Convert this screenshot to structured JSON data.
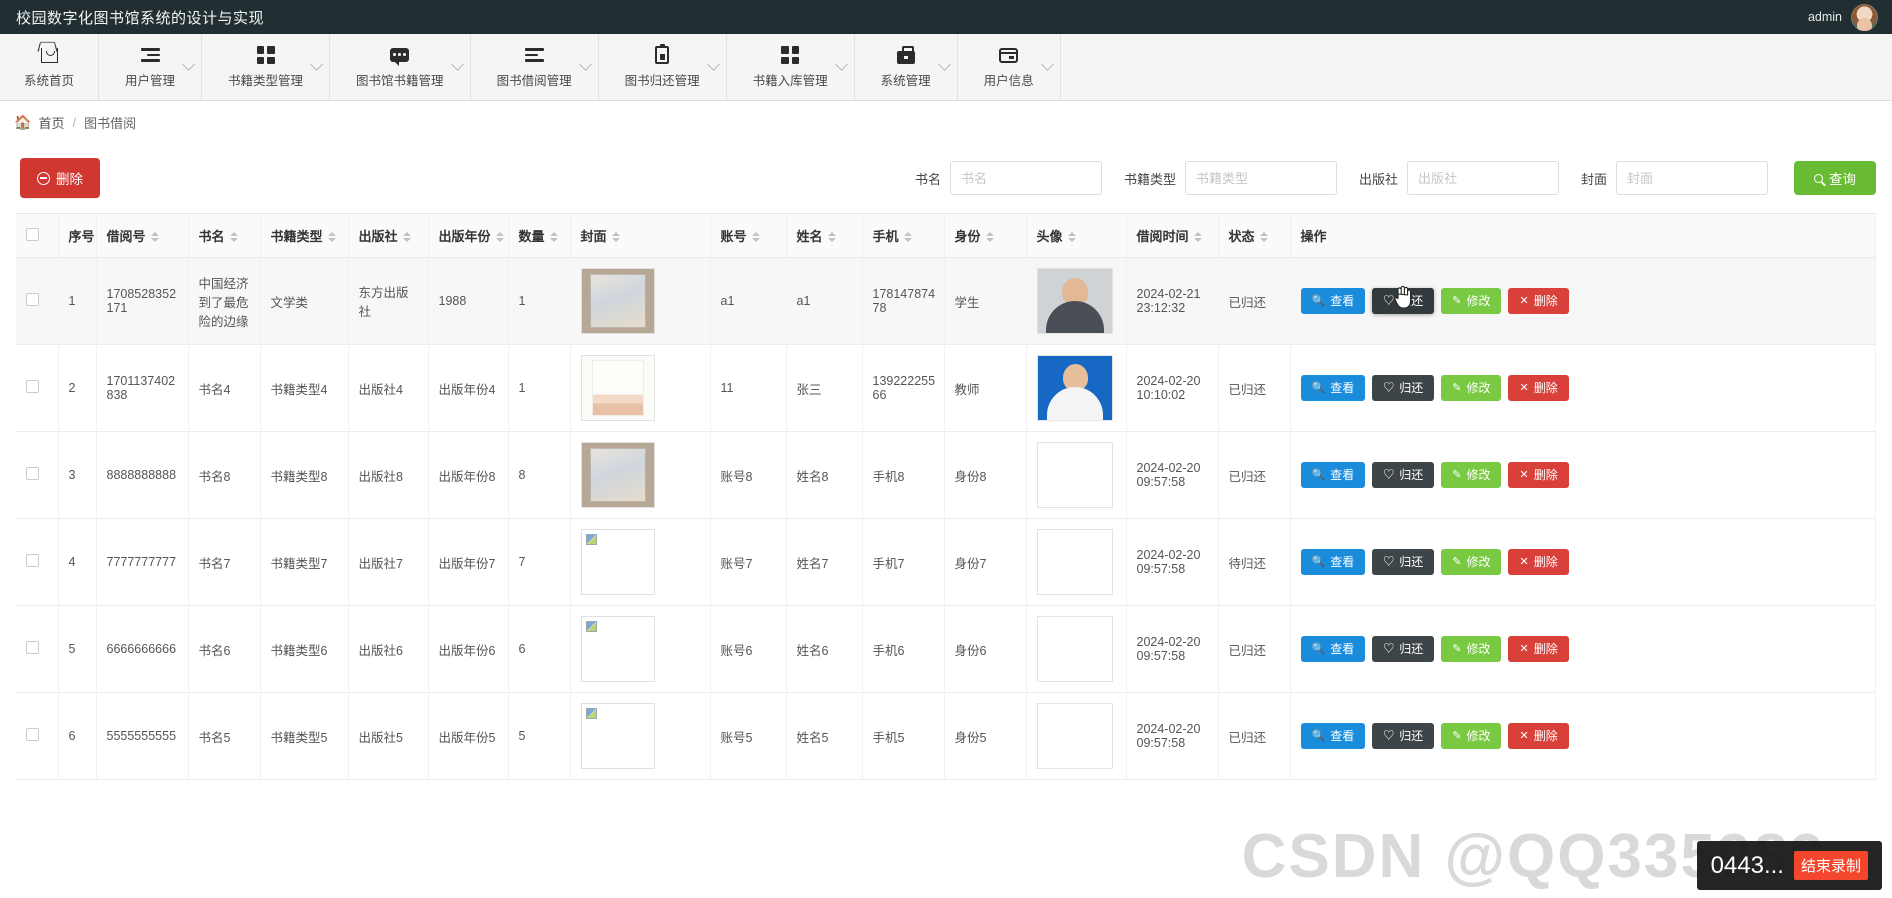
{
  "topbar": {
    "title": "校园数字化图书馆系统的设计与实现",
    "username": "admin",
    "avatar_icon": "user-avatar"
  },
  "nav": {
    "items": [
      {
        "label": "系统首页",
        "icon": "home-icon",
        "caret": false
      },
      {
        "label": "用户管理",
        "icon": "list-lines-icon",
        "caret": true
      },
      {
        "label": "书籍类型管理",
        "icon": "grid-icon",
        "caret": true
      },
      {
        "label": "图书馆书籍管理",
        "icon": "chat-icon",
        "caret": true
      },
      {
        "label": "图书借阅管理",
        "icon": "list-lines-icon",
        "caret": true
      },
      {
        "label": "图书归还管理",
        "icon": "clipboard-icon",
        "caret": true
      },
      {
        "label": "书籍入库管理",
        "icon": "grid-icon",
        "caret": true
      },
      {
        "label": "系统管理",
        "icon": "briefcase-icon",
        "caret": true
      },
      {
        "label": "用户信息",
        "icon": "card-icon",
        "caret": true
      }
    ]
  },
  "breadcrumb": {
    "home_icon": "home-icon",
    "home": "首页",
    "separator": "/",
    "current": "图书借阅"
  },
  "toolbar": {
    "delete_label": "删除",
    "delete_icon": "minus-circle-icon",
    "delete_color": "#cf3730"
  },
  "search": {
    "fields": [
      {
        "label": "书名",
        "placeholder": "书名",
        "value": ""
      },
      {
        "label": "书籍类型",
        "placeholder": "书籍类型",
        "value": ""
      },
      {
        "label": "出版社",
        "placeholder": "出版社",
        "value": ""
      },
      {
        "label": "封面",
        "placeholder": "封面",
        "value": ""
      }
    ],
    "button_label": "查询",
    "button_icon": "search-icon",
    "button_color": "#69bb33"
  },
  "table": {
    "columns": [
      {
        "label": "",
        "sortable": false,
        "key": "checkbox"
      },
      {
        "label": "序号",
        "sortable": false,
        "key": "index"
      },
      {
        "label": "借阅号",
        "sortable": true,
        "key": "borrow_no"
      },
      {
        "label": "书名",
        "sortable": true,
        "key": "book_name"
      },
      {
        "label": "书籍类型",
        "sortable": true,
        "key": "book_type"
      },
      {
        "label": "出版社",
        "sortable": true,
        "key": "publisher"
      },
      {
        "label": "出版年份",
        "sortable": true,
        "key": "year"
      },
      {
        "label": "数量",
        "sortable": true,
        "key": "qty"
      },
      {
        "label": "封面",
        "sortable": true,
        "key": "cover"
      },
      {
        "label": "账号",
        "sortable": true,
        "key": "account"
      },
      {
        "label": "姓名",
        "sortable": true,
        "key": "name"
      },
      {
        "label": "手机",
        "sortable": true,
        "key": "phone"
      },
      {
        "label": "身份",
        "sortable": true,
        "key": "identity"
      },
      {
        "label": "头像",
        "sortable": true,
        "key": "portrait"
      },
      {
        "label": "借阅时间",
        "sortable": true,
        "key": "borrow_time"
      },
      {
        "label": "状态",
        "sortable": true,
        "key": "status"
      },
      {
        "label": "操作",
        "sortable": false,
        "key": "actions"
      }
    ],
    "rows": [
      {
        "index": "1",
        "borrow_no": "1708528352171",
        "book_name": "中国经济到了最危险的边缘",
        "book_type": "文学类",
        "publisher": "东方出版社",
        "year": "1988",
        "qty": "1",
        "cover_kind": "bookA",
        "account": "a1",
        "name": "a1",
        "phone": "17814787478",
        "identity": "学生",
        "portrait_kind": "p1",
        "borrow_time": "2024-02-21 23:12:32",
        "status": "已归还",
        "highlight": true,
        "return_hover": true
      },
      {
        "index": "2",
        "borrow_no": "1701137402838",
        "book_name": "书名4",
        "book_type": "书籍类型4",
        "publisher": "出版社4",
        "year": "出版年份4",
        "qty": "1",
        "cover_kind": "bookB",
        "account": "11",
        "name": "张三",
        "phone": "13922225566",
        "identity": "教师",
        "portrait_kind": "p2",
        "borrow_time": "2024-02-20 10:10:02",
        "status": "已归还",
        "highlight": false,
        "return_hover": false
      },
      {
        "index": "3",
        "borrow_no": "8888888888",
        "book_name": "书名8",
        "book_type": "书籍类型8",
        "publisher": "出版社8",
        "year": "出版年份8",
        "qty": "8",
        "cover_kind": "bookA",
        "account": "账号8",
        "name": "姓名8",
        "phone": "手机8",
        "identity": "身份8",
        "portrait_kind": "blank",
        "borrow_time": "2024-02-20 09:57:58",
        "status": "已归还",
        "highlight": false,
        "return_hover": false
      },
      {
        "index": "4",
        "borrow_no": "7777777777",
        "book_name": "书名7",
        "book_type": "书籍类型7",
        "publisher": "出版社7",
        "year": "出版年份7",
        "qty": "7",
        "cover_kind": "broken",
        "account": "账号7",
        "name": "姓名7",
        "phone": "手机7",
        "identity": "身份7",
        "portrait_kind": "broken",
        "borrow_time": "2024-02-20 09:57:58",
        "status": "待归还",
        "highlight": false,
        "return_hover": false
      },
      {
        "index": "5",
        "borrow_no": "6666666666",
        "book_name": "书名6",
        "book_type": "书籍类型6",
        "publisher": "出版社6",
        "year": "出版年份6",
        "qty": "6",
        "cover_kind": "broken",
        "account": "账号6",
        "name": "姓名6",
        "phone": "手机6",
        "identity": "身份6",
        "portrait_kind": "broken",
        "borrow_time": "2024-02-20 09:57:58",
        "status": "已归还",
        "highlight": false,
        "return_hover": false
      },
      {
        "index": "6",
        "borrow_no": "5555555555",
        "book_name": "书名5",
        "book_type": "书籍类型5",
        "publisher": "出版社5",
        "year": "出版年份5",
        "qty": "5",
        "cover_kind": "broken",
        "account": "账号5",
        "name": "姓名5",
        "phone": "手机5",
        "identity": "身份5",
        "portrait_kind": "broken",
        "borrow_time": "2024-02-20 09:57:58",
        "status": "已归还",
        "highlight": false,
        "return_hover": false
      }
    ],
    "actions": {
      "view": {
        "label": "查看",
        "icon": "search-icon",
        "color": "#1b8cdb"
      },
      "return": {
        "label": "归还",
        "icon": "heart-icon",
        "color": "#3e4548"
      },
      "edit": {
        "label": "修改",
        "icon": "edit-icon",
        "color": "#7ac943"
      },
      "delete": {
        "label": "删除",
        "icon": "close-icon",
        "color": "#d9403a"
      }
    }
  },
  "watermark": {
    "text": "CSDN @QQ335989...",
    "tooltip_text": "0443...",
    "tooltip_badge": "结束录制"
  }
}
